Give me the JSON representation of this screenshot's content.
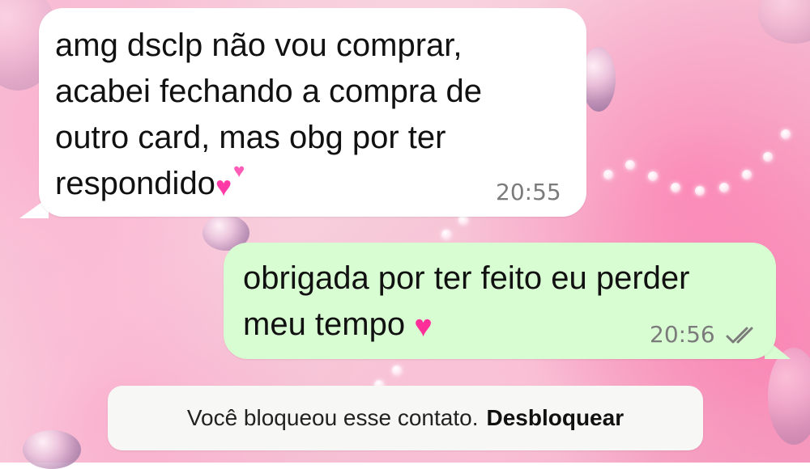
{
  "messages": {
    "incoming": {
      "lines": [
        "amg dsclp não vou comprar,",
        "acabei fechando a compra de",
        "outro card, mas obg por ter",
        "respondido"
      ],
      "time": "20:55"
    },
    "outgoing": {
      "lines": [
        "obrigada por ter feito eu perder",
        "meu tempo"
      ],
      "time": "20:56"
    }
  },
  "blocked_notice": {
    "text": "Você bloqueou esse contato.",
    "action": "Desbloquear"
  },
  "icons": {
    "incoming_emoji": "two-hearts-emoji",
    "outgoing_emoji": "pink-heart-emoji",
    "read_status": "double-check-icon"
  },
  "colors": {
    "outgoing_bubble": "#d9fdd3",
    "incoming_bubble": "#ffffff",
    "accent_heart": "#ff2f9a"
  }
}
